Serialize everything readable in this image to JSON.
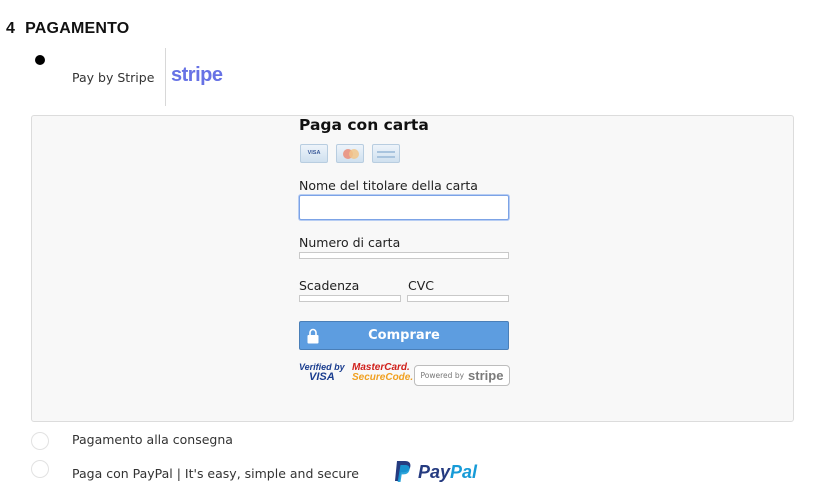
{
  "section": {
    "number": "4",
    "title": "PAGAMENTO"
  },
  "options": {
    "stripe": {
      "label": "Pay by Stripe",
      "logo_text": "stripe",
      "selected": true
    },
    "cod": {
      "label": "Pagamento alla consegna",
      "selected": false
    },
    "paypal": {
      "label": "Paga con PayPal | It's easy, simple and secure",
      "logo_text_a": "Pay",
      "logo_text_b": "Pal",
      "selected": false
    }
  },
  "card_form": {
    "title": "Paga con carta",
    "card_brand_icons": [
      "visa-card-icon",
      "mastercard-card-icon",
      "generic-card-icon"
    ],
    "visa_icon_text": "VISA",
    "holder_label": "Nome del titolare della carta",
    "holder_value": "",
    "number_label": "Numero di carta",
    "number_value": "",
    "expiry_label": "Scadenza",
    "expiry_value": "",
    "cvc_label": "CVC",
    "cvc_value": "",
    "buy_label": "Comprare"
  },
  "trust": {
    "vbv_a": "Verified by",
    "vbv_b": "VISA",
    "mc_a": "MasterCard.",
    "mc_b": "SecureCode.",
    "powered_a": "Powered by",
    "powered_b": "stripe"
  },
  "colors": {
    "accent_button": "#5d9de0",
    "stripe_brand": "#6772e5",
    "paypal_dark": "#253b80",
    "paypal_light": "#179bd7"
  }
}
